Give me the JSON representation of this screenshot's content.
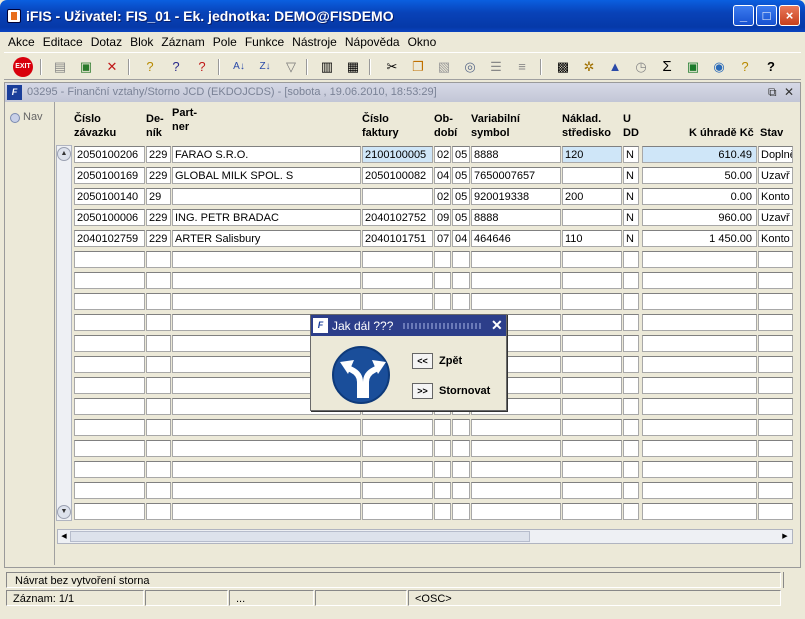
{
  "window": {
    "title": "iFIS - Uživatel: FIS_01 - Ek. jednotka: DEMO@FISDEMO"
  },
  "menu": [
    "Akce",
    "Editace",
    "Dotaz",
    "Blok",
    "Záznam",
    "Pole",
    "Funkce",
    "Nástroje",
    "Nápověda",
    "Okno"
  ],
  "toolbar": {
    "exit_label": "EXIT"
  },
  "form": {
    "title": "03295 - Finanční vztahy/Storno JCD (EKDOJCDS) - [sobota , 19.06.2010, 18:53:29]",
    "nav_label": "Nav",
    "columns": {
      "c1": [
        "Číslo",
        "závazku"
      ],
      "c2": [
        "De-",
        "ník"
      ],
      "c3": [
        "Part-",
        "ner"
      ],
      "c4": [
        "Číslo",
        "faktury"
      ],
      "c5": [
        "Ob-",
        "dobí"
      ],
      "c6": [
        "Variabilní",
        "symbol"
      ],
      "c7": [
        "Náklad.",
        "středisko"
      ],
      "c8": [
        "U",
        "DD"
      ],
      "c9": "K úhradě Kč",
      "c10": "Stav"
    },
    "rows": [
      {
        "cislo": "2050100206",
        "denik": "229",
        "partner": "FARAO S.R.O.",
        "faktura": "2100100005",
        "ob1": "02",
        "ob2": "05",
        "vs": "8888",
        "stredisko": "120",
        "udd": "N",
        "castka": "610.49",
        "stav": "Doplně"
      },
      {
        "cislo": "2050100169",
        "denik": "229",
        "partner": "GLOBAL MILK SPOL. S",
        "faktura": "2050100082",
        "ob1": "04",
        "ob2": "05",
        "vs": "7650007657",
        "stredisko": "",
        "udd": "N",
        "castka": "50.00",
        "stav": "Uzavř"
      },
      {
        "cislo": "2050100140",
        "denik": "29",
        "partner": "",
        "faktura": "",
        "ob1": "02",
        "ob2": "05",
        "vs": "920019338",
        "stredisko": "200",
        "udd": "N",
        "castka": "0.00",
        "stav": "Konto"
      },
      {
        "cislo": "2050100006",
        "denik": "229",
        "partner": "ING. PETR BRADAC",
        "faktura": "2040102752",
        "ob1": "09",
        "ob2": "05",
        "vs": "8888",
        "stredisko": "",
        "udd": "N",
        "castka": "960.00",
        "stav": "Uzavř"
      },
      {
        "cislo": "2040102759",
        "denik": "229",
        "partner": "ARTER Salisbury",
        "faktura": "2040101751",
        "ob1": "07",
        "ob2": "04",
        "vs": "464646",
        "stredisko": "110",
        "udd": "N",
        "castka": "1 450.00",
        "stav": "Konto"
      }
    ]
  },
  "dialog": {
    "title": "Jak dál ???",
    "back_btn": "<<",
    "back_label": "Zpět",
    "cancel_btn": ">>",
    "cancel_label": "Stornovat"
  },
  "status": {
    "message": "Návrat bez vytvoření storna",
    "record": "Záznam: 1/1",
    "dots": "...",
    "mode": "<OSC>"
  }
}
